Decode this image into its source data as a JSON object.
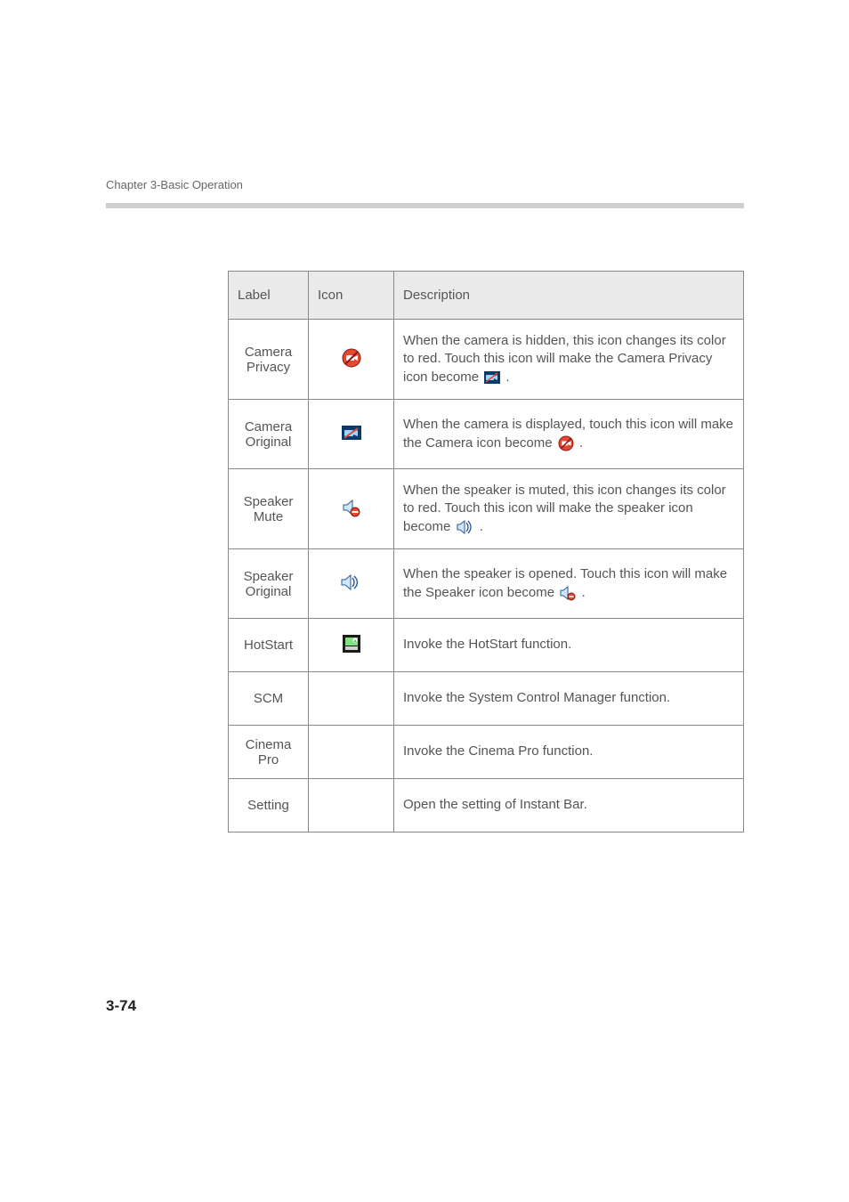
{
  "header": {
    "chapter": "Chapter 3-Basic Operation",
    "page_number": "3-74"
  },
  "table": {
    "columns": {
      "label": "Label",
      "icon": "Icon",
      "description": "Description"
    },
    "rows": [
      {
        "label": "Camera Privacy",
        "icon_name": "camera-privacy-red-icon",
        "description_before": "When the camera is hidden, this icon changes its color to red. Touch this icon will make the Camera Privacy icon become",
        "description_after": "."
      },
      {
        "label": "Camera Original",
        "icon_name": "camera-original-icon",
        "description_before": "When the camera is displayed, touch this icon will make the Camera icon become",
        "description_after": "."
      },
      {
        "label": "Speaker Mute",
        "icon_name": "speaker-mute-red-icon",
        "description_before": "When the speaker is muted, this icon changes its color to red. Touch this icon will make the speaker icon become",
        "description_after": "."
      },
      {
        "label": "Speaker Original",
        "icon_name": "speaker-original-icon",
        "description_before": "When the speaker is opened. Touch this icon will make the Speaker icon become",
        "description_after": "."
      },
      {
        "label": "HotStart",
        "icon_name": "hotstart-icon",
        "description": "Invoke the HotStart function."
      },
      {
        "label": "SCM",
        "icon_name": "",
        "description": "Invoke the System Control Manager function."
      },
      {
        "label": "Cinema Pro",
        "icon_name": "",
        "description": "Invoke the Cinema Pro function."
      },
      {
        "label": "Setting",
        "icon_name": "",
        "description": "Open the setting of Instant Bar."
      }
    ]
  }
}
